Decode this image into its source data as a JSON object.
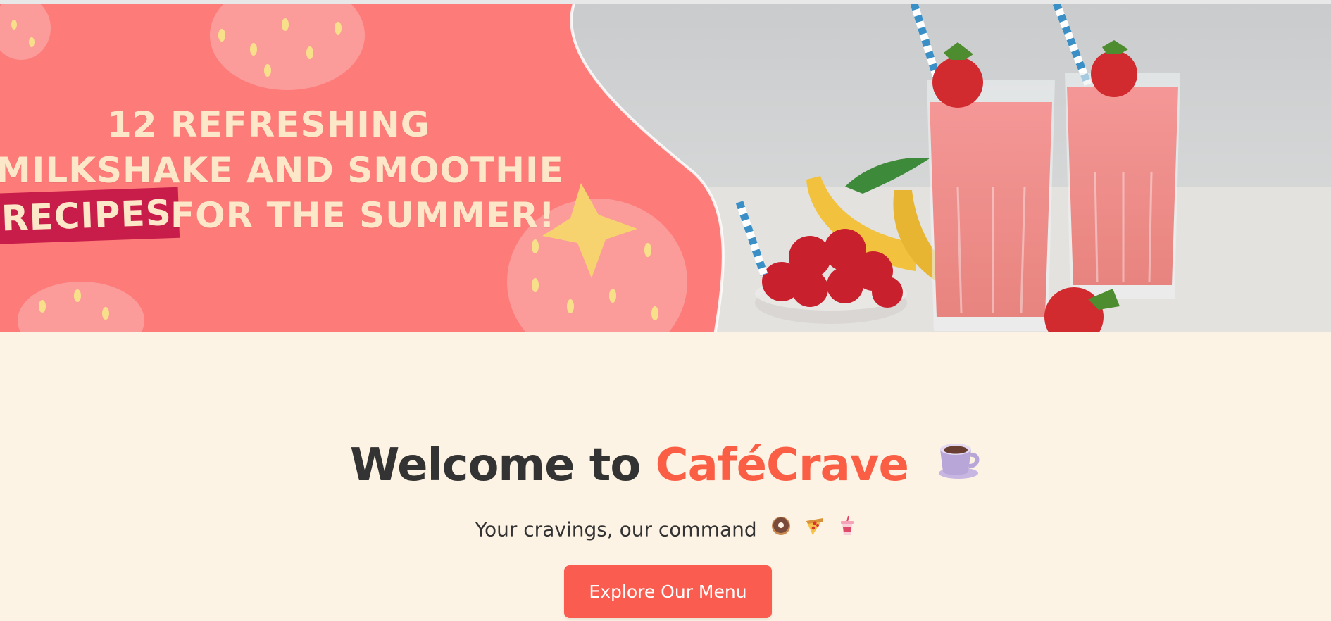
{
  "banner": {
    "line1": "12 REFRESHING",
    "line2": "MILKSHAKE AND SMOOTHIE",
    "highlight": "RECIPES",
    "line3": "FOR THE SUMMER!"
  },
  "hero": {
    "title_prefix": "Welcome to",
    "brand": "CaféCrave",
    "title_icon": "coffee-cup-icon",
    "subtitle": "Your cravings, our command",
    "subtitle_icons": [
      "donut-icon",
      "pizza-icon",
      "drink-cup-icon"
    ],
    "cta_label": "Explore Our Menu"
  },
  "colors": {
    "page_background": "#fdf3e4",
    "brand_accent": "#fa5f46",
    "button": "#fa5c4f",
    "banner_pink": "#fd7b78",
    "banner_highlight": "#c81d4a",
    "text_dark": "#333333"
  }
}
